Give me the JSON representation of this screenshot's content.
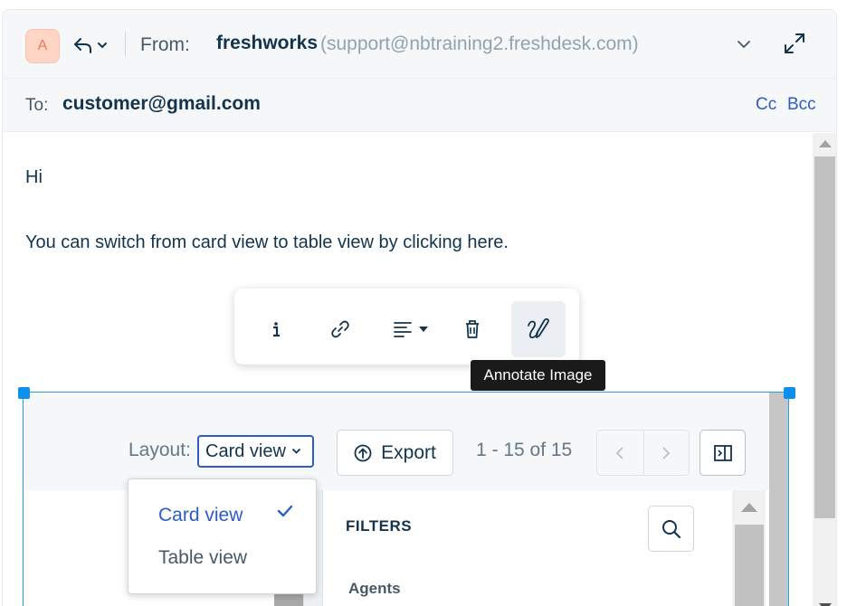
{
  "compose": {
    "avatar_initial": "A",
    "from_label": "From:",
    "from_name": "freshworks",
    "from_email": "(support@nbtraining2.freshdesk.com)",
    "to_label": "To:",
    "to_value": "customer@gmail.com",
    "cc_label": "Cc",
    "bcc_label": "Bcc"
  },
  "body": {
    "line1": "Hi",
    "line2": "You can switch from card view to table view by clicking here."
  },
  "image_toolbar": {
    "tooltip": "Annotate Image",
    "buttons": [
      "info",
      "link",
      "align",
      "delete",
      "annotate"
    ]
  },
  "embedded_screenshot": {
    "layout_label": "Layout:",
    "layout_value": "Card view",
    "export_label": "Export",
    "page_info": "1 - 15 of 15",
    "filters_title": "FILTERS",
    "agents_label": "Agents",
    "dropdown_options": [
      "Card view",
      "Table view"
    ],
    "selected_option": "Card view"
  },
  "colors": {
    "accent": "#2c5cc5",
    "text": "#12344d",
    "selection": "#0d8ff0",
    "avatar_bg": "#ffd6c6"
  }
}
